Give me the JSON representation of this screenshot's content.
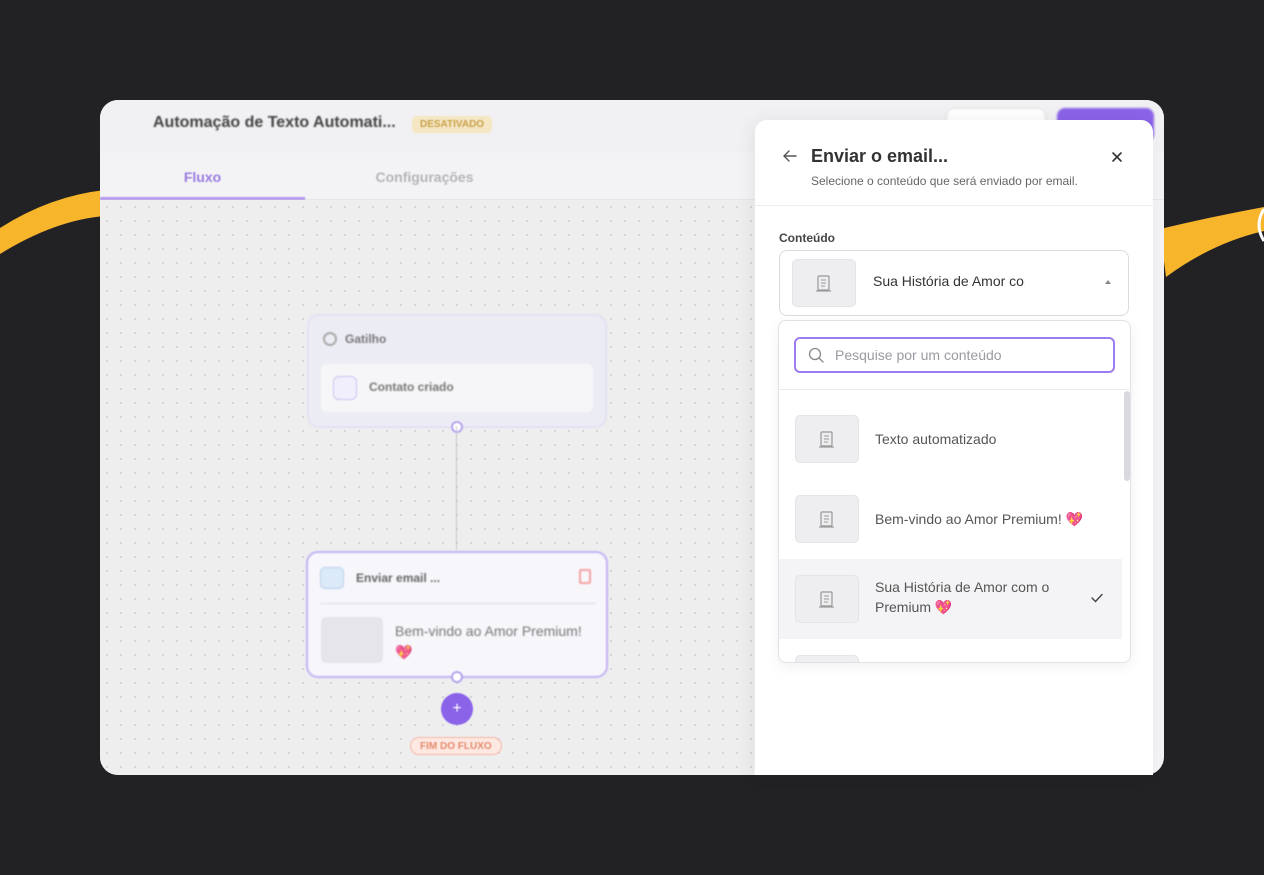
{
  "app": {
    "title": "Automação de Texto Automati...",
    "status_badge": "DESATIVADO"
  },
  "tabs": [
    {
      "label": "Fluxo",
      "active": true
    },
    {
      "label": "Configurações",
      "active": false
    }
  ],
  "flow": {
    "trigger": {
      "title": "Gatilho",
      "item": "Contato criado"
    },
    "action": {
      "title": "Enviar email ...",
      "content": "Bem-vindo ao Amor Premium!",
      "emoji": "💖"
    },
    "add_label": "+",
    "end_label": "FIM DO FLUXO"
  },
  "panel": {
    "title": "Enviar o email...",
    "subtitle": "Selecione o conteúdo que será enviado por email.",
    "field_label": "Conteúdo",
    "selected_value": "Sua História de Amor com o Premium 💖",
    "search_placeholder": "Pesquise por um conteúdo",
    "options": [
      {
        "label": "Texto automatizado",
        "emoji": "",
        "selected": false
      },
      {
        "label": "Bem-vindo ao Amor Premium!",
        "emoji": "💖",
        "selected": false
      },
      {
        "label": "Sua História de Amor com o Premium",
        "emoji": "💖",
        "selected": true
      }
    ]
  },
  "colors": {
    "accent": "#8a63e8",
    "background": "#222225",
    "swoosh": "#f7b52c"
  }
}
